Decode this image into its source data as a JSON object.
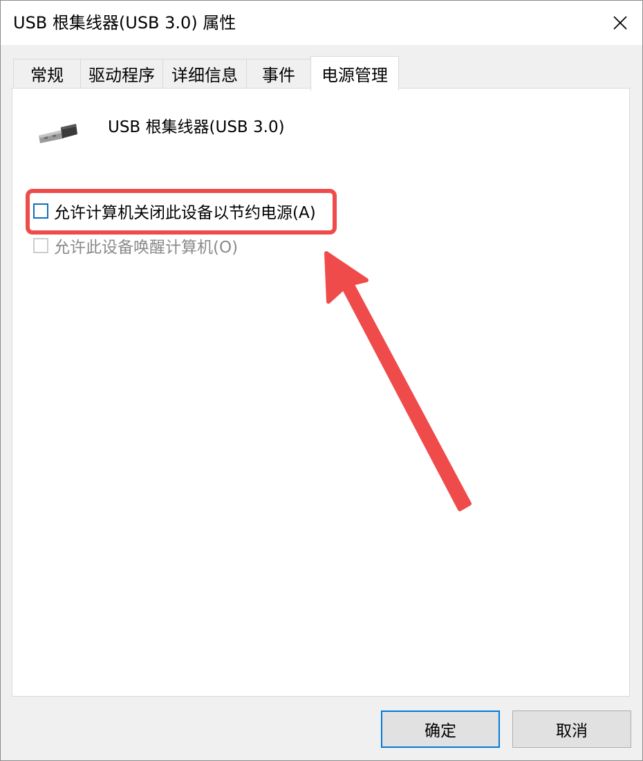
{
  "window": {
    "title": "USB 根集线器(USB 3.0) 属性"
  },
  "tabs": [
    {
      "label": "常规"
    },
    {
      "label": "驱动程序"
    },
    {
      "label": "详细信息"
    },
    {
      "label": "事件"
    },
    {
      "label": "电源管理",
      "active": true
    }
  ],
  "device": {
    "icon": "usb-plug-icon",
    "name": "USB 根集线器(USB 3.0)"
  },
  "options": [
    {
      "label": "允许计算机关闭此设备以节约电源(A)",
      "checked": false,
      "enabled": true
    },
    {
      "label": "允许此设备唤醒计算机(O)",
      "checked": false,
      "enabled": false
    }
  ],
  "annotation": {
    "color": "#f04b4b"
  },
  "buttons": {
    "ok": "确定",
    "cancel": "取消"
  }
}
